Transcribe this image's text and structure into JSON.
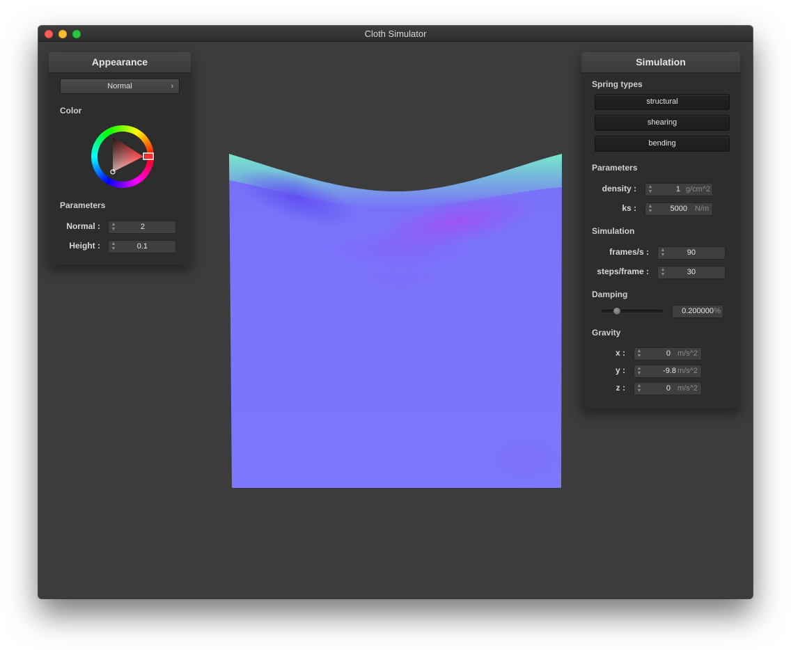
{
  "window": {
    "title": "Cloth Simulator"
  },
  "appearance": {
    "header": "Appearance",
    "shader_select": "Normal",
    "color_label": "Color",
    "parameters_label": "Parameters",
    "normal_label": "Normal :",
    "normal_value": "2",
    "height_label": "Height :",
    "height_value": "0.1",
    "color_wheel_hue": "#ff0000"
  },
  "simulation": {
    "header": "Simulation",
    "spring_types_label": "Spring types",
    "spring_buttons": [
      "structural",
      "shearing",
      "bending"
    ],
    "parameters_label": "Parameters",
    "density_label": "density :",
    "density_value": "1",
    "density_unit": "g/cm^2",
    "ks_label": "ks :",
    "ks_value": "5000",
    "ks_unit": "N/m",
    "simulation_label": "Simulation",
    "fps_label": "frames/s :",
    "fps_value": "90",
    "steps_label": "steps/frame :",
    "steps_value": "30",
    "damping_label": "Damping",
    "damping_value": "0.200000",
    "damping_unit": "%",
    "damping_fraction": 0.2,
    "gravity_label": "Gravity",
    "gx_label": "x :",
    "gx_value": "0",
    "gy_label": "y :",
    "gy_value": "-9.8",
    "gz_label": "z :",
    "gz_value": "0",
    "gravity_unit": "m/s^2"
  },
  "colors": {
    "background": "#3c3c3c",
    "panel": "#2d2d2d",
    "cloth_base": "#7a78fb",
    "cloth_top": "#6ff0b8",
    "cloth_fold": "#9a4cf2"
  }
}
